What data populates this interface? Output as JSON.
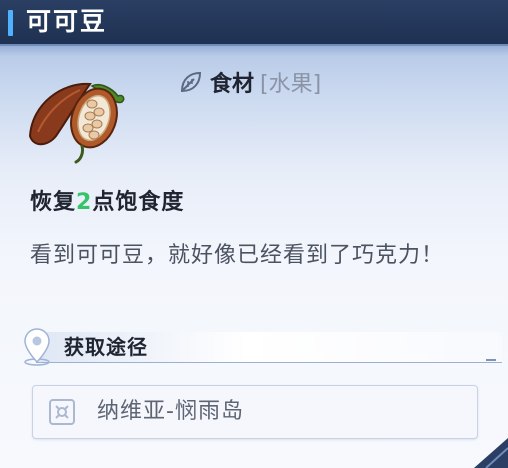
{
  "window": {
    "title": "可可豆"
  },
  "item": {
    "icon": "cocoa-pod-icon",
    "category_icon": "leaf-icon",
    "category": "食材",
    "subcategory": "[水果]"
  },
  "effect": {
    "prefix": "恢复",
    "amount": "2",
    "suffix": "点饱食度"
  },
  "description": "看到可可豆，就好像已经看到了巧克力！",
  "source": {
    "header_icon": "location-pin-icon",
    "header": "获取途径",
    "entries": [
      {
        "icon": "map-location-icon",
        "label": "纳维亚-悯雨岛"
      }
    ]
  },
  "colors": {
    "title_bar": "#1f3152",
    "accent": "#4fb2ff",
    "effect_number": "#37c36a"
  }
}
